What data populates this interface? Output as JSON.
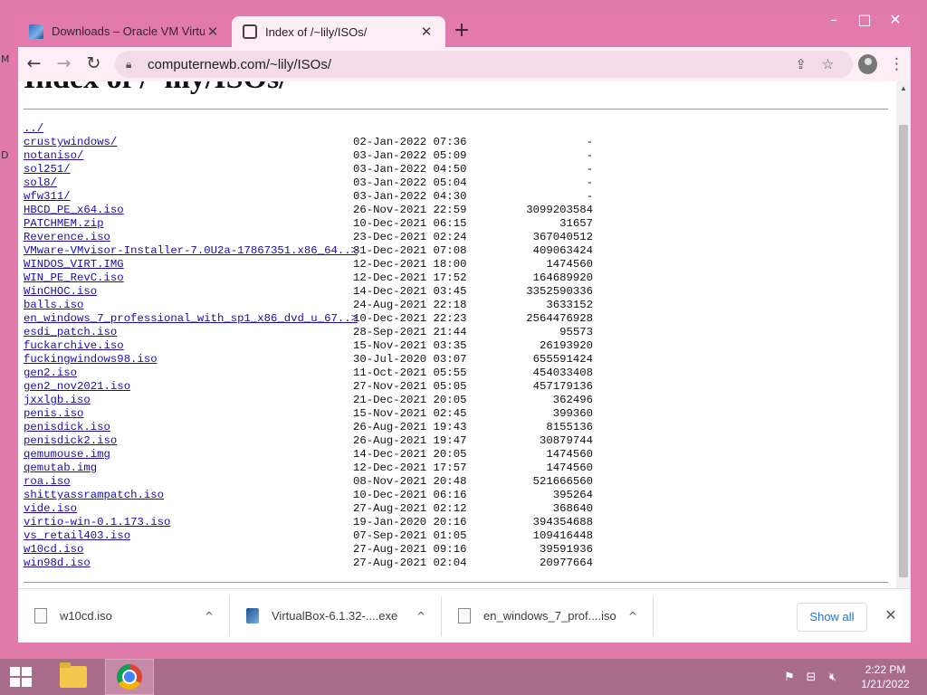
{
  "desktop": {
    "edge_labels": [
      "M",
      "D"
    ]
  },
  "window": {
    "minimize": "–",
    "maximize": "□",
    "close": "✕"
  },
  "tabs": [
    {
      "title": "Downloads – Oracle VM Virtual⊞",
      "close": "✕"
    },
    {
      "title": "Index of /~lily/ISOs/",
      "close": "✕"
    }
  ],
  "new_tab": "+",
  "toolbar": {
    "back": "←",
    "forward": "→",
    "reload": "↻",
    "url": "computernewb.com/~lily/ISOs/",
    "share": "⇪",
    "bookmark": "☆",
    "menu": "⋮"
  },
  "page": {
    "heading": "Index of /~lily/ISOs/",
    "listing": [
      {
        "name": "../",
        "date": "",
        "size": ""
      },
      {
        "name": "crustywindows/",
        "date": "02-Jan-2022 07:36",
        "size": "-"
      },
      {
        "name": "notaniso/",
        "date": "03-Jan-2022 05:09",
        "size": "-"
      },
      {
        "name": "sol251/",
        "date": "03-Jan-2022 04:50",
        "size": "-"
      },
      {
        "name": "sol8/",
        "date": "03-Jan-2022 05:04",
        "size": "-"
      },
      {
        "name": "wfw311/",
        "date": "03-Jan-2022 04:30",
        "size": "-"
      },
      {
        "name": "HBCD_PE_x64.iso",
        "date": "26-Nov-2021 22:59",
        "size": "3099203584"
      },
      {
        "name": "PATCHMEM.zip",
        "date": "10-Dec-2021 06:15",
        "size": "31657"
      },
      {
        "name": "Reverence.iso",
        "date": "23-Dec-2021 02:24",
        "size": "367040512"
      },
      {
        "name": "VMware-VMvisor-Installer-7.0U2a-17867351.x86_64..>",
        "date": "31-Dec-2021 07:08",
        "size": "409063424"
      },
      {
        "name": "WINDOS_VIRT.IMG",
        "date": "12-Dec-2021 18:00",
        "size": "1474560"
      },
      {
        "name": "WIN_PE_RevC.iso",
        "date": "12-Dec-2021 17:52",
        "size": "164689920"
      },
      {
        "name": "WinCHOC.iso",
        "date": "14-Dec-2021 03:45",
        "size": "3352590336"
      },
      {
        "name": "balls.iso",
        "date": "24-Aug-2021 22:18",
        "size": "3633152"
      },
      {
        "name": "en_windows_7_professional_with_sp1_x86_dvd_u_67..>",
        "date": "10-Dec-2021 22:23",
        "size": "2564476928"
      },
      {
        "name": "esdi_patch.iso",
        "date": "28-Sep-2021 21:44",
        "size": "95573"
      },
      {
        "name": "fuckarchive.iso",
        "date": "15-Nov-2021 03:35",
        "size": "26193920"
      },
      {
        "name": "fuckingwindows98.iso",
        "date": "30-Jul-2020 03:07",
        "size": "655591424"
      },
      {
        "name": "gen2.iso",
        "date": "11-Oct-2021 05:55",
        "size": "454033408"
      },
      {
        "name": "gen2_nov2021.iso",
        "date": "27-Nov-2021 05:05",
        "size": "457179136"
      },
      {
        "name": "jxxlgb.iso",
        "date": "21-Dec-2021 20:05",
        "size": "362496"
      },
      {
        "name": "penis.iso",
        "date": "15-Nov-2021 02:45",
        "size": "399360"
      },
      {
        "name": "penisdick.iso",
        "date": "26-Aug-2021 19:43",
        "size": "8155136"
      },
      {
        "name": "penisdick2.iso",
        "date": "26-Aug-2021 19:47",
        "size": "30879744"
      },
      {
        "name": "qemumouse.img",
        "date": "14-Dec-2021 20:05",
        "size": "1474560"
      },
      {
        "name": "qemutab.img",
        "date": "12-Dec-2021 17:57",
        "size": "1474560"
      },
      {
        "name": "roa.iso",
        "date": "08-Nov-2021 20:48",
        "size": "521666560"
      },
      {
        "name": "shittyassrampatch.iso",
        "date": "10-Dec-2021 06:16",
        "size": "395264"
      },
      {
        "name": "vide.iso",
        "date": "27-Aug-2021 02:12",
        "size": "368640"
      },
      {
        "name": "virtio-win-0.1.173.iso",
        "date": "19-Jan-2020 20:16",
        "size": "394354688"
      },
      {
        "name": "vs_retail403.iso",
        "date": "07-Sep-2021 01:05",
        "size": "109416448"
      },
      {
        "name": "w10cd.iso",
        "date": "27-Aug-2021 09:16",
        "size": "39591936"
      },
      {
        "name": "win98d.iso",
        "date": "27-Aug-2021 02:04",
        "size": "20977664"
      }
    ]
  },
  "downloads": {
    "items": [
      {
        "name": "w10cd.iso",
        "chevron": "^"
      },
      {
        "name": "VirtualBox-6.1.32-....exe",
        "chevron": "^"
      },
      {
        "name": "en_windows_7_prof....iso",
        "chevron": "^"
      }
    ],
    "show_all": "Show all",
    "close": "✕"
  },
  "taskbar": {
    "time": "2:22 PM",
    "date": "1/21/2022"
  }
}
